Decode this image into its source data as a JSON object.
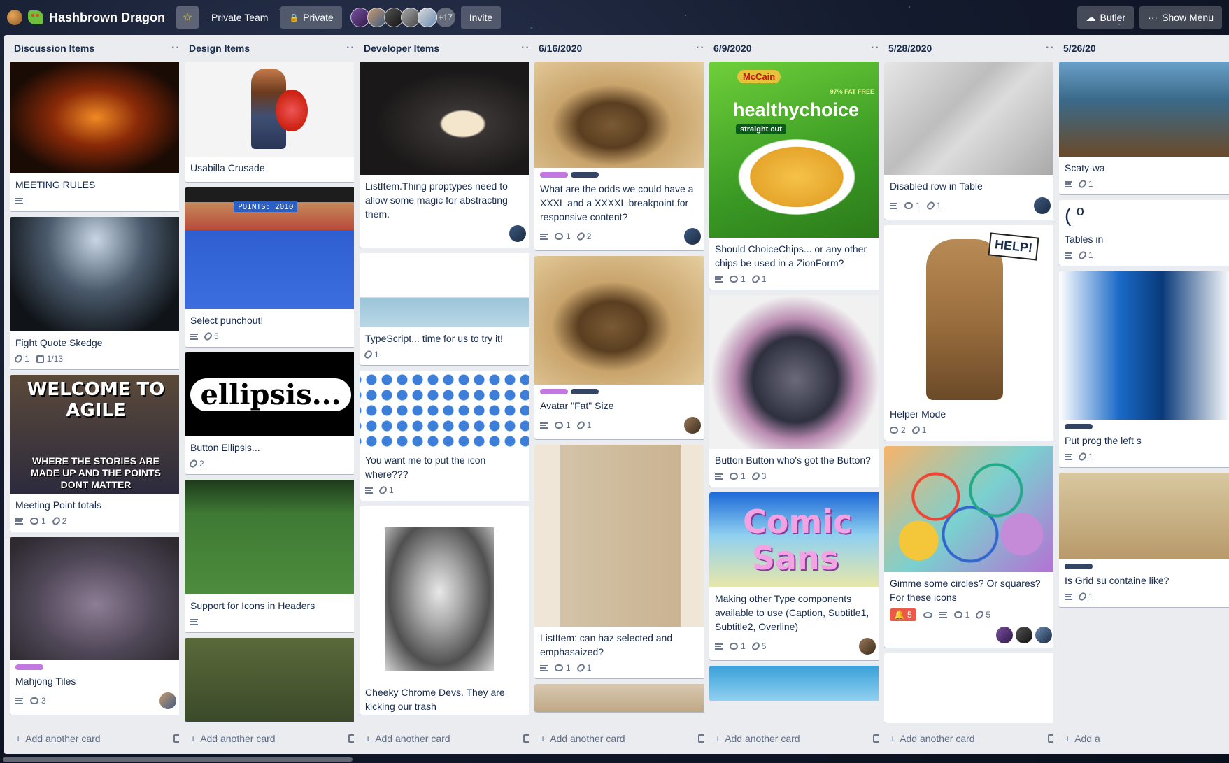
{
  "header": {
    "board_title": "Hashbrown Dragon",
    "team_button": "Private Team",
    "visibility_button": "Private",
    "member_count": "+17",
    "invite_button": "Invite",
    "butler_button": "Butler",
    "show_menu_button": "Show Menu"
  },
  "lists": [
    {
      "title": "Discussion Items",
      "add_card": "Add another card",
      "cards": [
        {
          "title": "MEETING RULES",
          "badges": {
            "description": true
          }
        },
        {
          "title": "Fight Quote Skedge",
          "badges": {
            "attachments": "1",
            "checklist": "1/13"
          }
        },
        {
          "title": "Meeting Point totals",
          "cover_text_top": "WELCOME TO AGILE",
          "cover_text_bottom": "WHERE THE STORIES ARE MADE UP AND THE POINTS DONT MATTER",
          "badges": {
            "description": true,
            "comments": "1",
            "attachments": "2"
          }
        },
        {
          "title": "Mahjong Tiles",
          "badges": {
            "description": true,
            "comments": "3"
          }
        }
      ]
    },
    {
      "title": "Design Items",
      "add_card": "Add another card",
      "cards": [
        {
          "title": "Usabilla Crusade"
        },
        {
          "title": "Select punchout!",
          "cover_text": "POINTS: 2010",
          "badges": {
            "description": true,
            "attachments": "5"
          }
        },
        {
          "title": "Button Ellipsis...",
          "cover_text": "ellipsis...",
          "badges": {
            "attachments": "2"
          }
        },
        {
          "title": "Support for Icons in Headers",
          "badges": {
            "description": true
          }
        }
      ]
    },
    {
      "title": "Developer Items",
      "add_card": "Add another card",
      "cards": [
        {
          "title": "ListItem.Thing proptypes need to allow some magic for abstracting them."
        },
        {
          "title": "TypeScript... time for us to try it!",
          "badges": {
            "attachments": "1"
          }
        },
        {
          "title": "You want me to put the icon where???",
          "badges": {
            "description": true,
            "attachments": "1"
          }
        },
        {
          "title": "Cheeky Chrome Devs. They are kicking our trash"
        }
      ]
    },
    {
      "title": "6/16/2020",
      "add_card": "Add another card",
      "cards": [
        {
          "title": "What are the odds we could have a XXXL and a XXXXL breakpoint for responsive content?",
          "badges": {
            "description": true,
            "comments": "1",
            "attachments": "2"
          }
        },
        {
          "title": "Avatar \"Fat\" Size",
          "badges": {
            "description": true,
            "comments": "1",
            "attachments": "1"
          }
        },
        {
          "title": "ListItem: can haz selected and emphasaized?",
          "badges": {
            "description": true,
            "comments": "1",
            "attachments": "1"
          }
        }
      ]
    },
    {
      "title": "6/9/2020",
      "add_card": "Add another card",
      "cards": [
        {
          "title": "Should ChoiceChips... or any other chips be used in a ZionForm?",
          "cover_brand": "McCain",
          "cover_product": "healthychoice",
          "cover_tag": "97% FAT FREE",
          "cover_sub": "straight cut",
          "badges": {
            "description": true,
            "comments": "1",
            "attachments": "1"
          }
        },
        {
          "title": "Button Button who's got the Button?",
          "badges": {
            "description": true,
            "comments": "1",
            "attachments": "3"
          }
        },
        {
          "title": "Making other Type components available to use (Caption, Subtitle1, Subtitle2, Overline)",
          "cover_text": "Comic Sans",
          "badges": {
            "description": true,
            "comments": "1",
            "attachments": "5"
          }
        }
      ]
    },
    {
      "title": "5/28/2020",
      "add_card": "Add another card",
      "cards": [
        {
          "title": "Disabled row in Table",
          "badges": {
            "description": true,
            "comments": "1",
            "attachments": "1"
          }
        },
        {
          "title": "Helper Mode",
          "cover_sign": "HELP!",
          "badges": {
            "comments": "2",
            "attachments": "1"
          }
        },
        {
          "title": "Gimme some circles? Or squares? For these icons",
          "badges": {
            "notifications": "5",
            "watch": true,
            "description": true,
            "comments": "1",
            "attachments": "5"
          }
        }
      ]
    },
    {
      "title": "5/26/20",
      "add_card": "Add a",
      "cards": [
        {
          "title": "Scaty-wa",
          "badges": {
            "description": true,
            "attachments": "1"
          }
        },
        {
          "title": "Tables in",
          "badges": {
            "description": true,
            "attachments": "1"
          }
        },
        {
          "title": "Put prog the left s",
          "badges": {
            "description": true,
            "attachments": "1"
          }
        },
        {
          "title": "Is Grid su containe like?",
          "badges": {
            "description": true,
            "attachments": "1"
          }
        }
      ]
    }
  ],
  "colors": {
    "label_purple": "#c377e0",
    "label_navy": "#344563",
    "notification_red": "#eb5a46"
  }
}
